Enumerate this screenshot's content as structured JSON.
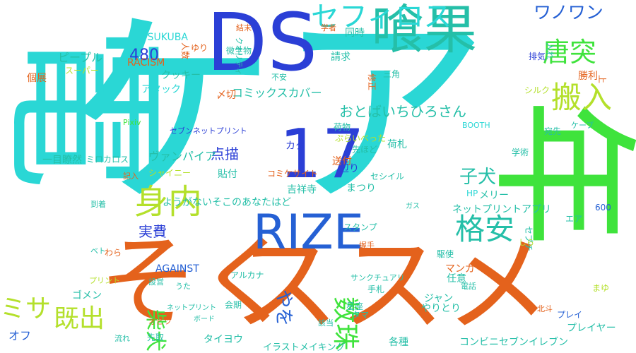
{
  "colors": {
    "background": "#ffffff",
    "cyan": "#2ad7d5",
    "blue": "#2b3fd6",
    "royal": "#2560d4",
    "green": "#3fe33c",
    "lime": "#b4e02b",
    "orange": "#e4621c",
    "teal": "#25bfa8"
  },
  "words": [
    {
      "text": "ケア",
      "color": "cyan"
    },
    {
      "text": "電",
      "color": "cyan"
    },
    {
      "text": "年",
      "color": "green"
    },
    {
      "text": "そく",
      "color": "orange"
    },
    {
      "text": "ススメ",
      "color": "orange"
    },
    {
      "text": "DS",
      "color": "blue"
    },
    {
      "text": "喰果",
      "color": "teal"
    },
    {
      "text": "17",
      "color": "blue"
    },
    {
      "text": "RIZE",
      "color": "royal"
    },
    {
      "text": "セフィロス",
      "color": "cyan"
    },
    {
      "text": "ワノワン",
      "color": "royal"
    },
    {
      "text": "唐突",
      "color": "green"
    },
    {
      "text": "搬入",
      "color": "lime"
    },
    {
      "text": "身内",
      "color": "lime"
    },
    {
      "text": "格安",
      "color": "teal"
    },
    {
      "text": "数珠",
      "color": "green"
    },
    {
      "text": "ミサ",
      "color": "lime"
    },
    {
      "text": "既出",
      "color": "lime"
    },
    {
      "text": "柴犬",
      "color": "green"
    },
    {
      "text": "やを",
      "color": "royal"
    },
    {
      "text": "子犬",
      "color": "teal"
    },
    {
      "text": "おとばいちひろさん",
      "color": "teal"
    },
    {
      "text": "480",
      "color": "blue"
    },
    {
      "text": "ピープル",
      "color": "teal"
    },
    {
      "text": "点描",
      "color": "blue"
    },
    {
      "text": "実費",
      "color": "blue"
    },
    {
      "text": "ヴァンパイア",
      "color": "teal"
    },
    {
      "text": "コミックスカバー",
      "color": "teal"
    },
    {
      "text": "TSUKUBA",
      "color": "cyan"
    },
    {
      "text": "RACISM",
      "color": "orange"
    },
    {
      "text": "クッキー",
      "color": "teal"
    },
    {
      "text": "アタック",
      "color": "cyan"
    },
    {
      "text": "〆切",
      "color": "orange"
    },
    {
      "text": "スーパー",
      "color": "lime"
    },
    {
      "text": "ゆり",
      "color": "orange"
    },
    {
      "text": "個展",
      "color": "orange"
    },
    {
      "text": "結末",
      "color": "orange"
    },
    {
      "text": "クオリティ",
      "color": "teal"
    },
    {
      "text": "微生物",
      "color": "teal"
    },
    {
      "text": "学者",
      "color": "orange"
    },
    {
      "text": "同時",
      "color": "teal"
    },
    {
      "text": "請求",
      "color": "teal"
    },
    {
      "text": "入れ",
      "color": "teal"
    },
    {
      "text": "排気",
      "color": "blue"
    },
    {
      "text": "三角",
      "color": "teal"
    },
    {
      "text": "不安",
      "color": "teal"
    },
    {
      "text": "シルク",
      "color": "lime"
    },
    {
      "text": "勝利",
      "color": "orange"
    },
    {
      "text": "一目瞭然",
      "color": "teal"
    },
    {
      "text": "ミロカロス",
      "color": "teal"
    },
    {
      "text": "シャイニー",
      "color": "lime"
    },
    {
      "text": "セブンネットプリント",
      "color": "blue"
    },
    {
      "text": "Pixiv",
      "color": "green"
    },
    {
      "text": "荷物",
      "color": "teal"
    },
    {
      "text": "ぷらいべった",
      "color": "lime"
    },
    {
      "text": "先ほど",
      "color": "teal"
    },
    {
      "text": "荷札",
      "color": "teal"
    },
    {
      "text": "BOOTH",
      "color": "cyan"
    },
    {
      "text": "ケーブ",
      "color": "teal"
    },
    {
      "text": "宛先",
      "color": "teal"
    },
    {
      "text": "学術",
      "color": "teal"
    },
    {
      "text": "貼付",
      "color": "teal"
    },
    {
      "text": "送付",
      "color": "orange"
    },
    {
      "text": "辺り",
      "color": "blue"
    },
    {
      "text": "カタ",
      "color": "blue"
    },
    {
      "text": "コミケサイト",
      "color": "orange"
    },
    {
      "text": "セシイル",
      "color": "teal"
    },
    {
      "text": "吉祥寺",
      "color": "teal"
    },
    {
      "text": "まつり",
      "color": "teal"
    },
    {
      "text": "メリー",
      "color": "teal"
    },
    {
      "text": "ようがないそこのあなたはど",
      "color": "teal"
    },
    {
      "text": "ネットプリントアプリ",
      "color": "teal"
    },
    {
      "text": "HP",
      "color": "cyan"
    },
    {
      "text": "600",
      "color": "royal"
    },
    {
      "text": "記入",
      "color": "orange"
    },
    {
      "text": "到着",
      "color": "teal"
    },
    {
      "text": "わら",
      "color": "orange"
    },
    {
      "text": "ガス",
      "color": "teal"
    },
    {
      "text": "スタンプ",
      "color": "teal"
    },
    {
      "text": "エア",
      "color": "teal"
    },
    {
      "text": "セブチ",
      "color": "teal"
    },
    {
      "text": "しら",
      "color": "lime"
    },
    {
      "text": "ベト",
      "color": "teal"
    },
    {
      "text": "握手",
      "color": "orange"
    },
    {
      "text": "駆使",
      "color": "teal"
    },
    {
      "text": "AGAINST",
      "color": "royal"
    },
    {
      "text": "アルカナ",
      "color": "teal"
    },
    {
      "text": "マンガ",
      "color": "orange"
    },
    {
      "text": "任意",
      "color": "teal"
    },
    {
      "text": "プリント",
      "color": "lime"
    },
    {
      "text": "設営",
      "color": "teal"
    },
    {
      "text": "うた",
      "color": "teal"
    },
    {
      "text": "サンクチュアリ",
      "color": "teal"
    },
    {
      "text": "会期",
      "color": "teal"
    },
    {
      "text": "手札",
      "color": "teal"
    },
    {
      "text": "電話",
      "color": "teal"
    },
    {
      "text": "まゆ",
      "color": "lime"
    },
    {
      "text": "ゴメン",
      "color": "teal"
    },
    {
      "text": "星座",
      "color": "teal"
    },
    {
      "text": "ジャン",
      "color": "teal"
    },
    {
      "text": "やりとり",
      "color": "teal"
    },
    {
      "text": "北斗",
      "color": "orange"
    },
    {
      "text": "オフ",
      "color": "royal"
    },
    {
      "text": "ネットプリント",
      "color": "teal"
    },
    {
      "text": "ボード",
      "color": "teal"
    },
    {
      "text": "タマ",
      "color": "teal"
    },
    {
      "text": "オビツ",
      "color": "orange"
    },
    {
      "text": "該当",
      "color": "teal"
    },
    {
      "text": "プレイ",
      "color": "royal"
    },
    {
      "text": "プレイヤー",
      "color": "teal"
    },
    {
      "text": "流れ",
      "color": "teal"
    },
    {
      "text": "先取",
      "color": "teal"
    },
    {
      "text": "タイヨウ",
      "color": "teal"
    },
    {
      "text": "イラストメイキング",
      "color": "teal"
    },
    {
      "text": "各種",
      "color": "teal"
    },
    {
      "text": "コンビニセブンイレブン",
      "color": "teal"
    },
    {
      "text": "人数",
      "color": "orange"
    },
    {
      "text": "上",
      "color": "orange"
    },
    {
      "text": "修正",
      "color": "orange"
    }
  ]
}
